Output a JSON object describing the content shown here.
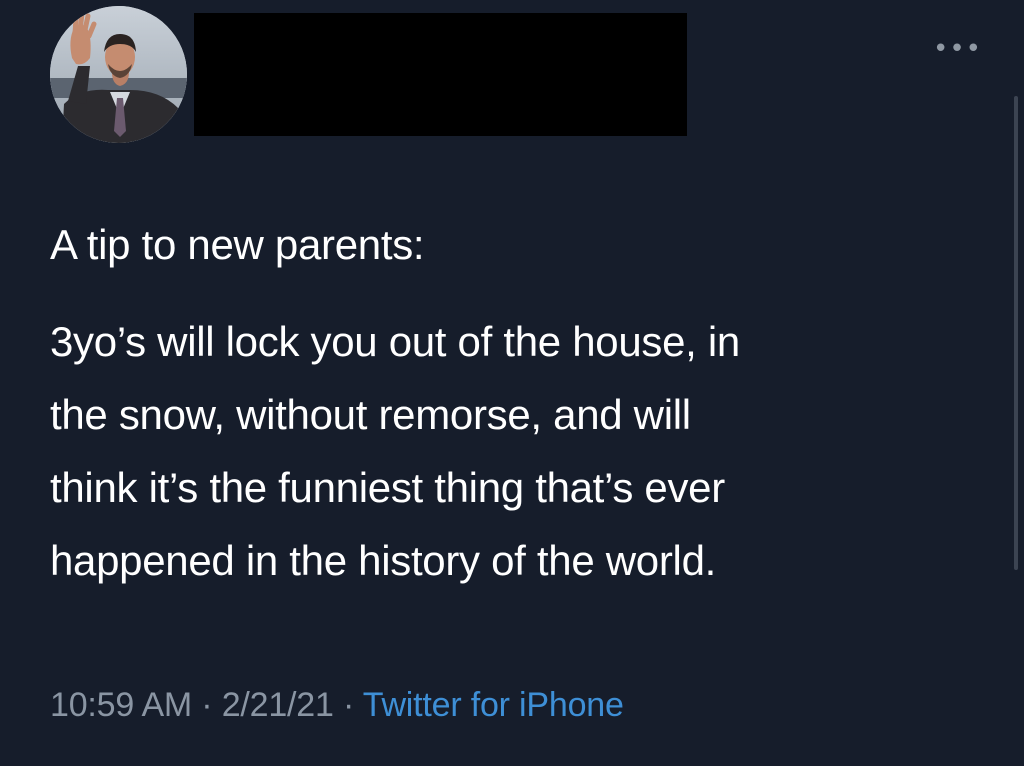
{
  "tweet": {
    "avatar_icon": "user-avatar-photo",
    "more_icon": "more-options-icon",
    "more_glyph": "•••",
    "heading": "A tip to new parents:",
    "body_lines": [
      "3yo’s will lock you out of the house, in",
      "the snow, without remorse, and will",
      "think it’s the funniest thing that’s ever",
      "happened in the history of the world."
    ],
    "time": "10:59 AM",
    "separator": " · ",
    "date": "2/21/21",
    "source": "Twitter for iPhone"
  },
  "colors": {
    "background": "#161d2b",
    "text": "#ffffff",
    "muted": "#8a95a3",
    "link": "#3e8fd6",
    "redaction": "#000000"
  }
}
